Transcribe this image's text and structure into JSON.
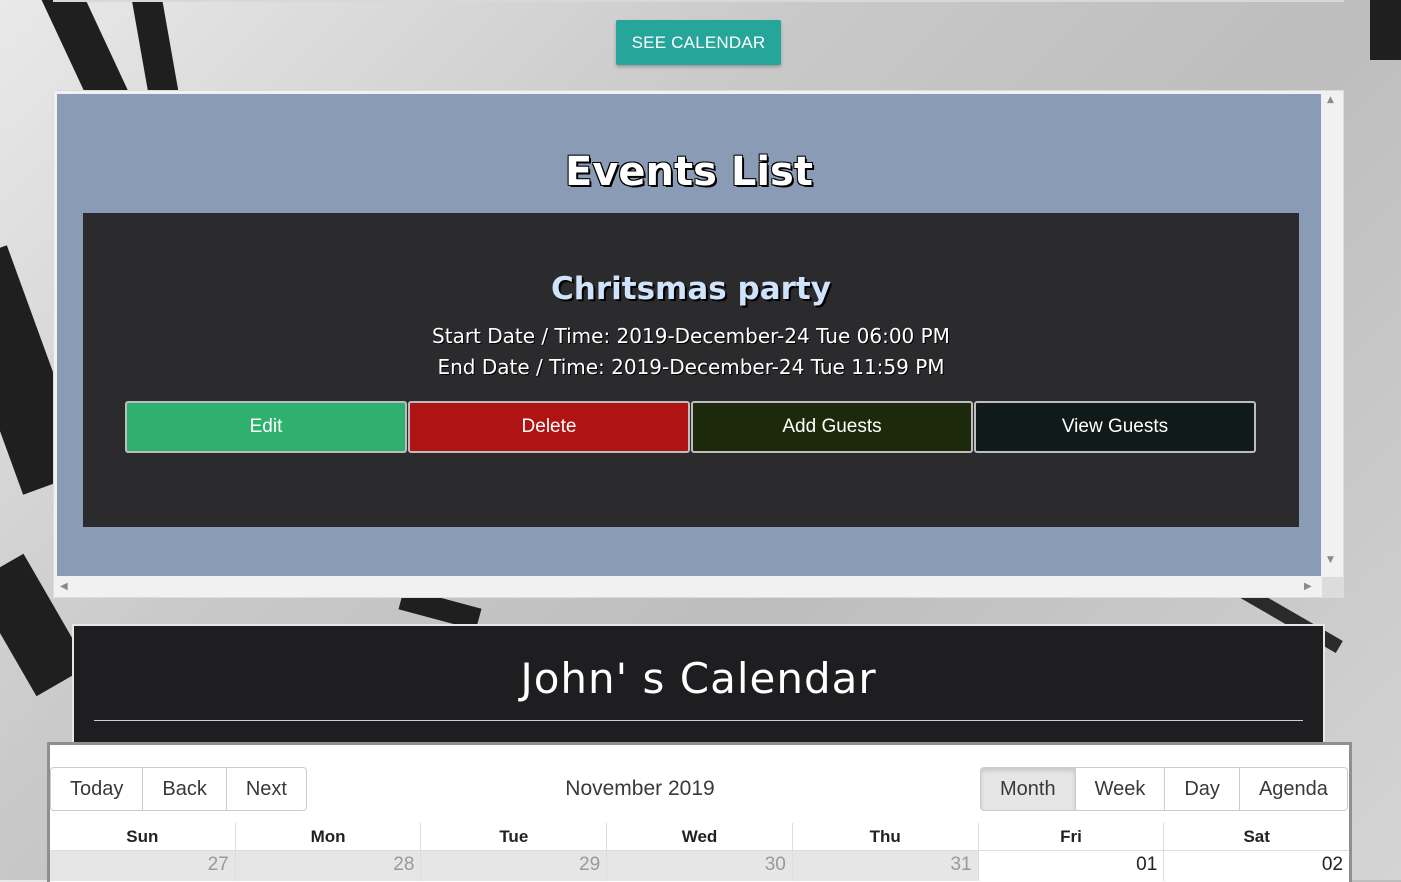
{
  "header": {
    "see_calendar_label": "SEE CALENDAR"
  },
  "events": {
    "title": "Events List",
    "items": [
      {
        "name": "Chritsmas party",
        "start": "Start Date / Time: 2019-December-24 Tue 06:00 PM",
        "end": "End Date / Time: 2019-December-24 Tue 11:59 PM",
        "actions": {
          "edit": "Edit",
          "delete": "Delete",
          "add_guests": "Add Guests",
          "view_guests": "View Guests"
        }
      }
    ]
  },
  "calendar": {
    "title": "John' s Calendar",
    "toolbar": {
      "nav": [
        "Today",
        "Back",
        "Next"
      ],
      "label": "November 2019",
      "views": [
        "Month",
        "Week",
        "Day",
        "Agenda"
      ],
      "active_view": "Month"
    },
    "weekdays": [
      "Sun",
      "Mon",
      "Tue",
      "Wed",
      "Thu",
      "Fri",
      "Sat"
    ],
    "first_row": [
      "27",
      "28",
      "29",
      "30",
      "31",
      "01",
      "02"
    ]
  },
  "colors": {
    "see_calendar": "#26a69a",
    "edit": "#2fb06e",
    "delete": "#b01313",
    "add_guests": "#1c2a0b",
    "view_guests": "#101a18"
  }
}
